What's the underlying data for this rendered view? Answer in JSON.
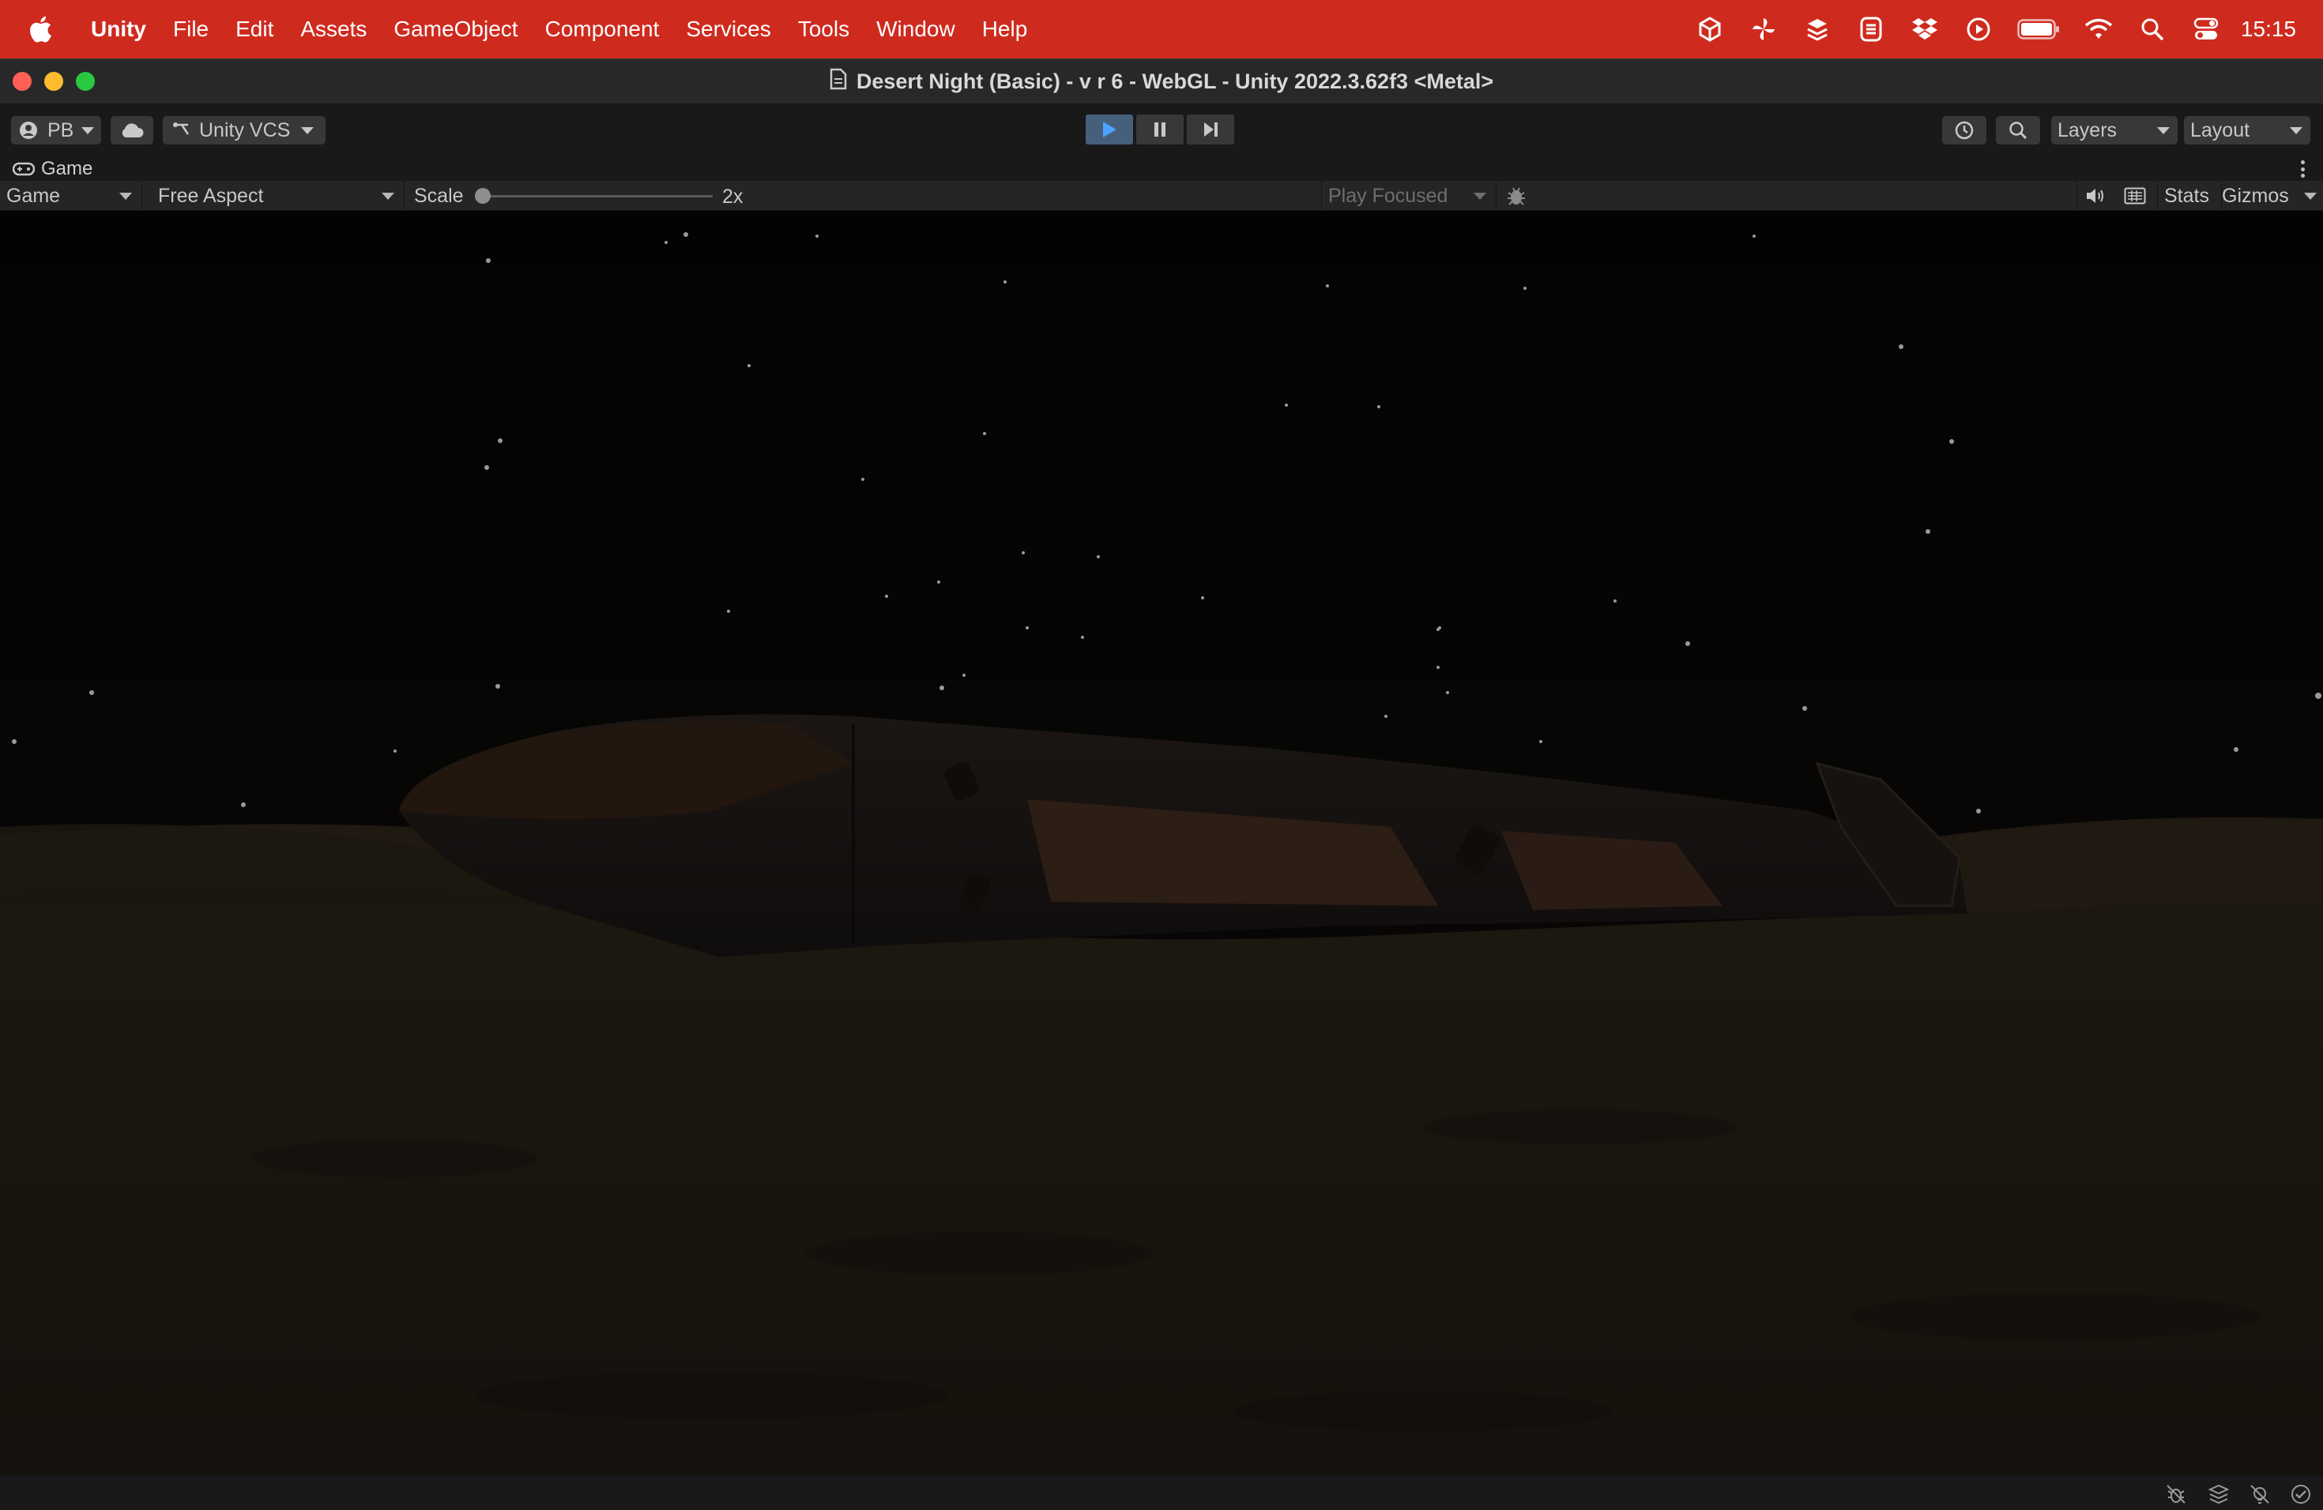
{
  "menubar": {
    "app_name": "Unity",
    "items": [
      "File",
      "Edit",
      "Assets",
      "GameObject",
      "Component",
      "Services",
      "Tools",
      "Window",
      "Help"
    ],
    "clock": "15:15",
    "status_icons": [
      "unity-hub-icon",
      "pinwheel-icon",
      "stack-icon",
      "shield-icon",
      "dropbox-icon",
      "play-circle-icon",
      "battery-icon",
      "wifi-icon",
      "search-icon",
      "control-center-icon"
    ]
  },
  "window": {
    "title": "Desert Night (Basic) - v r 6 - WebGL - Unity 2022.3.62f3 <Metal>"
  },
  "toolbar": {
    "account_label": "PB",
    "vcs_label": "Unity VCS",
    "layers_label": "Layers",
    "layout_label": "Layout",
    "play_state": "playing"
  },
  "game_tab": {
    "label": "Game"
  },
  "game_toolbar": {
    "display_label": "Game",
    "aspect_label": "Free Aspect",
    "scale_label": "Scale",
    "scale_value": "2x",
    "play_mode_label": "Play Focused",
    "stats_label": "Stats",
    "gizmos_label": "Gizmos"
  },
  "colors": {
    "menubar_bg": "#cf2a1e",
    "play_active": "#46607c",
    "panel_bg": "#191919",
    "toolbar_bg": "#252525"
  }
}
